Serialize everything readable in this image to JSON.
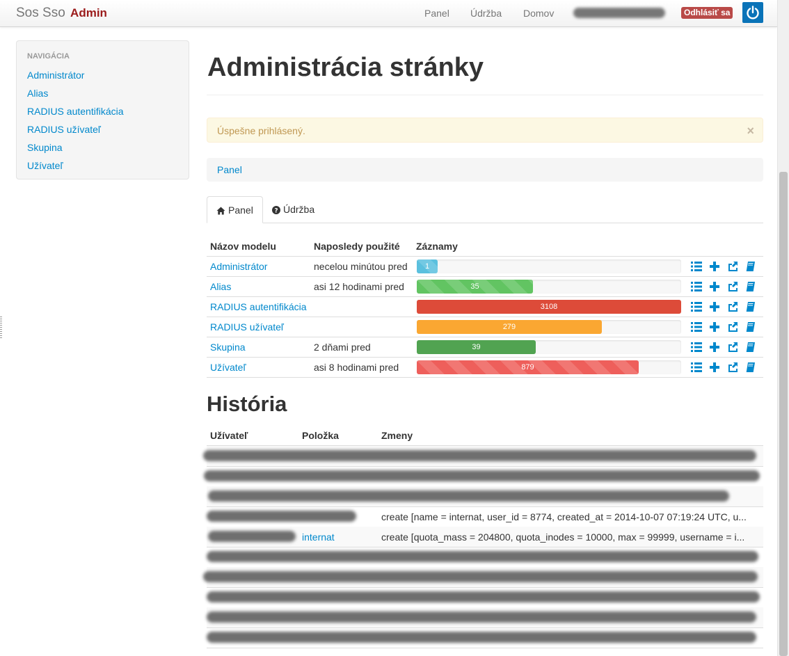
{
  "navbar": {
    "brand": "Sos Sso",
    "brand_admin": "Admin",
    "links": [
      "Panel",
      "Údržba",
      "Domov"
    ],
    "logout": "Odhlásiť sa",
    "power_icon": "power-icon"
  },
  "sidebar": {
    "header": "NAVIGÁCIA",
    "items": [
      "Administrátor",
      "Alias",
      "RADIUS autentifikácia",
      "RADIUS užívateľ",
      "Skupina",
      "Užívateľ"
    ]
  },
  "main": {
    "title": "Administrácia stránky",
    "alert": "Úspešne prihlásený.",
    "alert_close": "×",
    "breadcrumb": "Panel",
    "tabs": [
      {
        "label": "Panel",
        "icon": "home-icon",
        "active": true
      },
      {
        "label": "Údržba",
        "icon": "question-circle-icon",
        "active": false
      }
    ]
  },
  "models": {
    "headers": [
      "Názov modelu",
      "Naposledy použité",
      "Záznamy"
    ],
    "max_records": 3108,
    "rows": [
      {
        "name": "Administrátor",
        "last_used": "necelou minútou pred",
        "records": "1",
        "fraction": 0.08,
        "color": "#5bc0de",
        "striped": true
      },
      {
        "name": "Alias",
        "last_used": "asi 12 hodinami pred",
        "records": "35",
        "fraction": 0.44,
        "color": "#62c462",
        "striped": true
      },
      {
        "name": "RADIUS autentifikácia",
        "last_used": "",
        "records": "3108",
        "fraction": 1.0,
        "color": "#dd4b39",
        "striped": false
      },
      {
        "name": "RADIUS užívateľ",
        "last_used": "",
        "records": "279",
        "fraction": 0.7,
        "color": "#faa732",
        "striped": false
      },
      {
        "name": "Skupina",
        "last_used": "2 dňami pred",
        "records": "39",
        "fraction": 0.45,
        "color": "#51a351",
        "striped": false
      },
      {
        "name": "Užívateľ",
        "last_used": "asi 8 hodinami pred",
        "records": "879",
        "fraction": 0.84,
        "color": "#ee5f5b",
        "striped": true
      }
    ],
    "action_icons": [
      "list-icon",
      "plus-icon",
      "share-icon",
      "book-icon"
    ]
  },
  "history": {
    "title": "História",
    "headers": [
      "Užívateľ",
      "Položka",
      "Zmeny"
    ],
    "rows": [
      {
        "item": "",
        "changes": ""
      },
      {
        "item": "",
        "changes": ""
      },
      {
        "item": "",
        "changes": ""
      },
      {
        "item": "",
        "changes": "create [name = internat, user_id = 8774, created_at = 2014-10-07 07:19:24 UTC, u..."
      },
      {
        "item": "internat",
        "changes": "create [quota_mass = 204800, quota_inodes = 10000, max = 99999, username = i..."
      },
      {
        "item": "",
        "changes": ""
      },
      {
        "item": "",
        "changes": ""
      },
      {
        "item": "",
        "changes": ""
      },
      {
        "item": "",
        "changes": ""
      },
      {
        "item": "",
        "changes": ""
      }
    ]
  }
}
